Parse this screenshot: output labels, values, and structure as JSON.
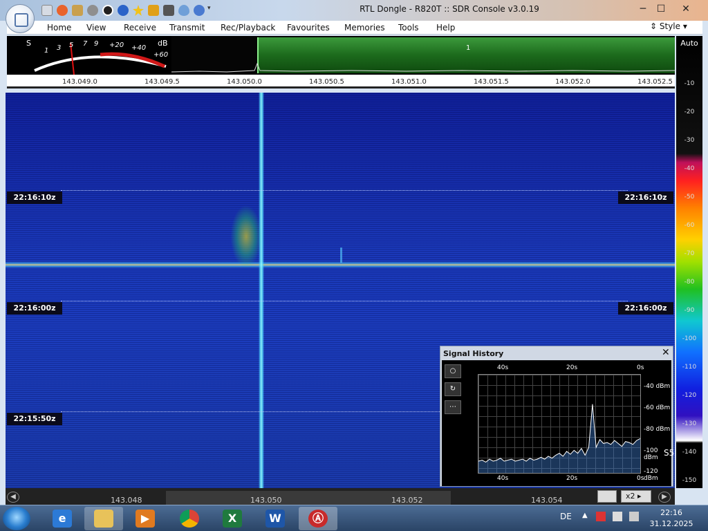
{
  "window": {
    "title": "RTL Dongle - R820T :: SDR Console v3.0.19",
    "minimize": "─",
    "maximize": "☐",
    "close": "✕"
  },
  "menu": {
    "items": [
      "Home",
      "View",
      "Receive",
      "Transmit",
      "Rec/Playback",
      "Favourites",
      "Memories",
      "Tools",
      "Help"
    ],
    "style_label": "Style"
  },
  "meter": {
    "s_label": "S",
    "db_label": "dB",
    "scale": [
      "1",
      "3",
      "5",
      "7",
      "9",
      "+20",
      "+40",
      "+60"
    ]
  },
  "spectrum": {
    "marker_label": "1"
  },
  "freq_scale": [
    "143.049.0",
    "143.049.5",
    "143.050.0",
    "143.050.5",
    "143.051.0",
    "143.051.5",
    "143.052.0",
    "143.052.5"
  ],
  "colorbar": {
    "auto_label": "Auto",
    "values": [
      "-10",
      "-20",
      "-30",
      "-40",
      "-50",
      "-60",
      "-70",
      "-80",
      "-90",
      "-100",
      "-110",
      "-120",
      "-130",
      "-140",
      "-150"
    ]
  },
  "waterfall": {
    "time_labels": [
      "22:16:10z",
      "22:16:00z",
      "22:15:50z"
    ]
  },
  "bottom_scale": {
    "values": [
      "143.048",
      "143.050",
      "143.052",
      "143.054"
    ],
    "zoom_label": "x2"
  },
  "signal_history": {
    "title": "Signal History",
    "close": "✕",
    "x_top": [
      "40s",
      "20s",
      "0s"
    ],
    "x_bottom": [
      "40s",
      "20s",
      "0s"
    ],
    "y_labels": [
      "-40 dBm",
      "-60 dBm",
      "-80 dBm",
      "-100 dBm",
      "-120 dBm"
    ],
    "s_reading": "S5",
    "trace_dbm": [
      -118,
      -117,
      -119,
      -116,
      -118,
      -117,
      -115,
      -118,
      -117,
      -116,
      -118,
      -117,
      -116,
      -118,
      -115,
      -117,
      -116,
      -114,
      -116,
      -113,
      -115,
      -112,
      -110,
      -113,
      -108,
      -111,
      -107,
      -110,
      -105,
      -112,
      -104,
      -60,
      -104,
      -96,
      -100,
      -99,
      -101,
      -97,
      -100,
      -103,
      -98,
      -99,
      -101,
      -97,
      -95
    ]
  },
  "taskbar": {
    "language": "DE",
    "time": "22:16",
    "date": "31.12.2025"
  }
}
